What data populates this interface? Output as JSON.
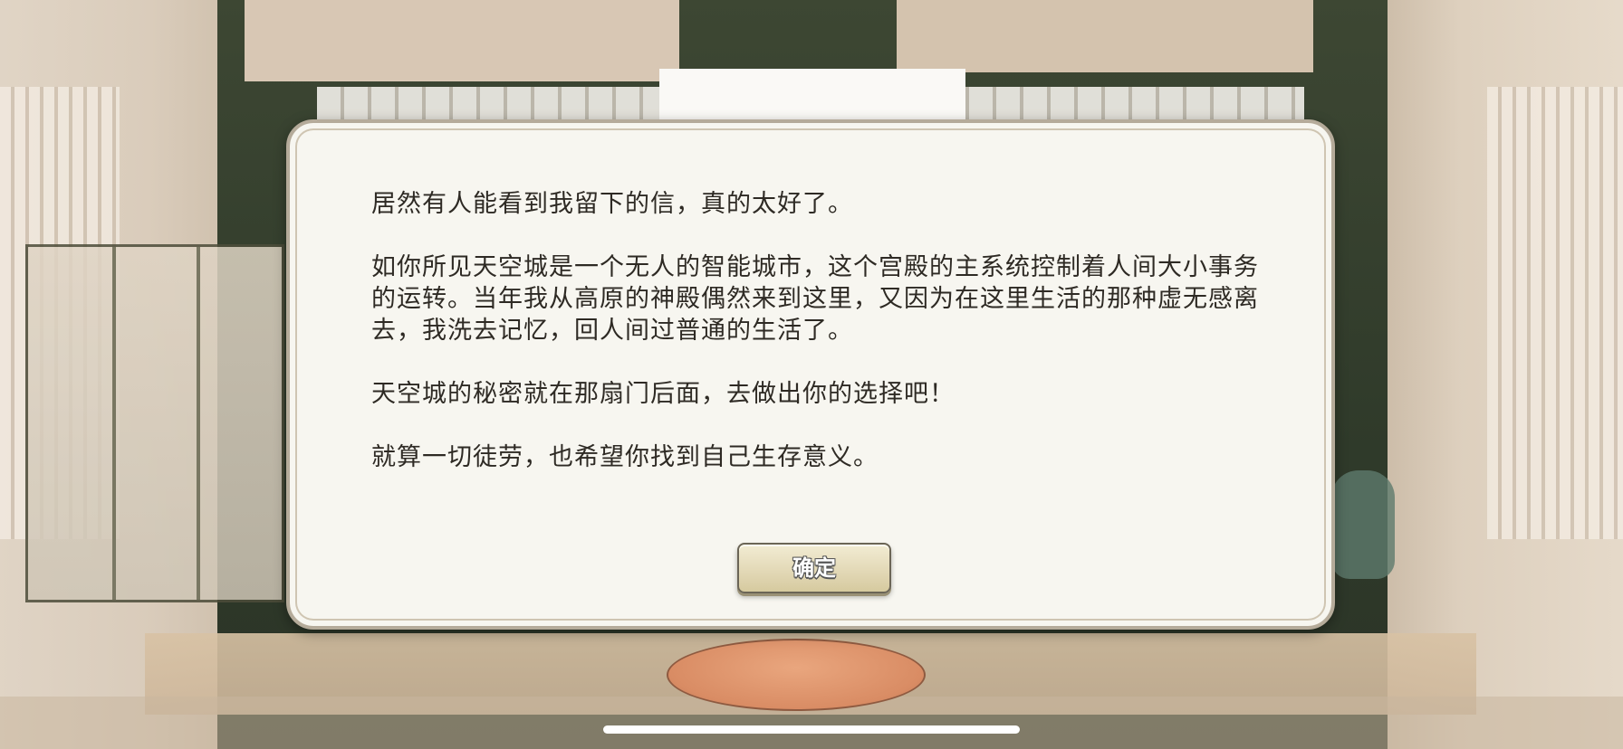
{
  "dialog": {
    "paragraphs": [
      "居然有人能看到我留下的信，真的太好了。",
      "如你所见天空城是一个无人的智能城市，这个宫殿的主系统控制着人间大小事务的运转。当年我从高原的神殿偶然来到这里，又因为在这里生活的那种虚无感离去，我洗去记忆，回人间过普通的生活了。",
      "天空城的秘密就在那扇门后面，去做出你的选择吧！",
      "就算一切徒劳，也希望你找到自己生存意义。"
    ],
    "confirm_label": "确定"
  },
  "colors": {
    "dialog_background": "#f7f6f0",
    "dialog_border": "#b5ab9a",
    "button_fill": "#e3d9b7",
    "text": "#2e2a24"
  }
}
